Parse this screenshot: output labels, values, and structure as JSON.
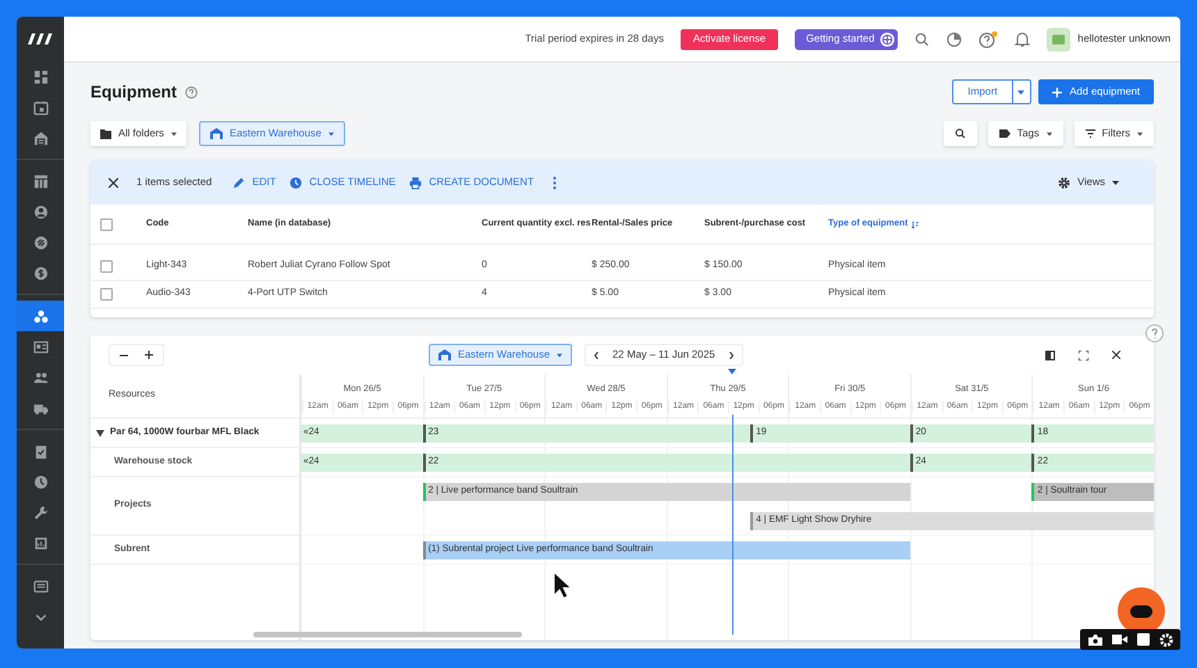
{
  "sidebar": {
    "items": [
      {
        "selected": false
      },
      {
        "selected": false
      },
      {
        "selected": false
      },
      {
        "selected": false
      },
      {
        "selected": false
      },
      {
        "selected": false
      },
      {
        "selected": false
      },
      {
        "selected": true
      },
      {
        "selected": false
      },
      {
        "selected": false
      },
      {
        "selected": false
      },
      {
        "selected": false
      },
      {
        "selected": false
      },
      {
        "selected": false
      },
      {
        "selected": false
      },
      {
        "selected": false
      },
      {
        "selected": false
      }
    ]
  },
  "topbar": {
    "trial_notice": "Trial period expires in 28 days",
    "activate_button": "Activate license",
    "getting_started_button": "Getting started",
    "help_has_notification": true,
    "user_name": "hellotester unknown"
  },
  "page": {
    "title": "Equipment",
    "import_button": "Import",
    "add_button": "Add equipment"
  },
  "filters": {
    "folder": "All folders",
    "warehouse": "Eastern Warehouse",
    "tags": "Tags",
    "filters": "Filters"
  },
  "selection_bar": {
    "count": "1 items selected",
    "actions": [
      "EDIT",
      "CLOSE TIMELINE",
      "CREATE DOCUMENT"
    ],
    "views": "Views"
  },
  "table": {
    "all_checked": false,
    "columns": [
      {
        "label": "Code",
        "sorted": false
      },
      {
        "label": "Name (in database)",
        "sorted": false
      },
      {
        "label": "Current quantity excl. res",
        "sorted": false
      },
      {
        "label": "Rental-/Sales price",
        "sorted": false
      },
      {
        "label": "Subrent-/purchase cost",
        "sorted": false
      },
      {
        "label": "Type of equipment",
        "sorted": true
      }
    ],
    "rows": [
      {
        "checked": false,
        "cells": [
          "Light-343",
          "Robert Juliat Cyrano Follow Spot",
          "0",
          "$ 250.00",
          "$ 150.00",
          "Physical item"
        ]
      },
      {
        "checked": false,
        "cells": [
          "Audio-343",
          "4-Port UTP Switch",
          "4",
          "$ 5.00",
          "$ 3.00",
          "Physical item"
        ]
      }
    ]
  },
  "timeline": {
    "warehouse": "Eastern Warehouse",
    "range": "22 May – 11 Jun 2025",
    "resources_heading": "Resources",
    "days": [
      {
        "label": "Mon 26/5",
        "ticks": [
          "12am",
          "06am",
          "12pm",
          "06pm"
        ]
      },
      {
        "label": "Tue 27/5",
        "ticks": [
          "12am",
          "06am",
          "12pm",
          "06pm"
        ]
      },
      {
        "label": "Wed 28/5",
        "ticks": [
          "12am",
          "06am",
          "12pm",
          "06pm"
        ]
      },
      {
        "label": "Thu 29/5",
        "ticks": [
          "12am",
          "06am",
          "12pm",
          "06pm"
        ]
      },
      {
        "label": "Fri 30/5",
        "ticks": [
          "12am",
          "06am",
          "12pm",
          "06pm"
        ]
      },
      {
        "label": "Sat 31/5",
        "ticks": [
          "12am",
          "06am",
          "12pm",
          "06pm"
        ]
      },
      {
        "label": "Sun 1/6",
        "ticks": [
          "12am",
          "06am",
          "12pm",
          "06pm"
        ]
      }
    ],
    "rows": [
      {
        "label": "Par 64, 1000W fourbar MFL Black",
        "kind": "group",
        "expanded": true,
        "lanes": [
          [
            {
              "text": "«24",
              "color": "#d3f1dc"
            },
            {
              "text": "23",
              "color": "#d3f1dc",
              "edge": {
                "color": "#555555"
              }
            },
            {
              "text": "19",
              "color": "#d3f1dc",
              "edge": {
                "color": "#555555"
              }
            },
            {
              "text": "20",
              "color": "#d3f1dc",
              "edge": {
                "color": "#555555"
              }
            },
            {
              "text": "18",
              "color": "#d3f1dc",
              "edge": {
                "color": "#555555"
              }
            }
          ]
        ]
      },
      {
        "label": "Warehouse stock",
        "kind": "child",
        "lanes": [
          [
            {
              "text": "«24",
              "color": "#d3f1dc"
            },
            {
              "text": "22",
              "color": "#d3f1dc",
              "edge": {
                "color": "#555555"
              }
            },
            {
              "text": "24",
              "color": "#d3f1dc",
              "edge": {
                "color": "#555555"
              }
            },
            {
              "text": "22",
              "color": "#d3f1dc",
              "edge": {
                "color": "#555555"
              }
            }
          ]
        ]
      },
      {
        "label": "Projects",
        "kind": "child",
        "lanes": [
          [
            {
              "text": "2 | Live performance band Soultrain",
              "color": "#d4d4d4",
              "edge": {
                "color": "#22c55e"
              }
            },
            {
              "text": "2 | Soultrain tour",
              "color": "#bdbdbd",
              "edge": {
                "color": "#22c55e"
              }
            }
          ],
          [
            {
              "text": "4 | EMF Light Show Dryhire",
              "color": "#dcdcdc",
              "edge": {
                "color": "#999999"
              }
            }
          ]
        ]
      },
      {
        "label": "Subrent",
        "kind": "child",
        "lanes": [
          [
            {
              "text": "(1) Subrental project Live performance band Soultrain",
              "color": "#a9cff5",
              "edge": {
                "color": "#888888"
              }
            }
          ]
        ]
      }
    ]
  }
}
